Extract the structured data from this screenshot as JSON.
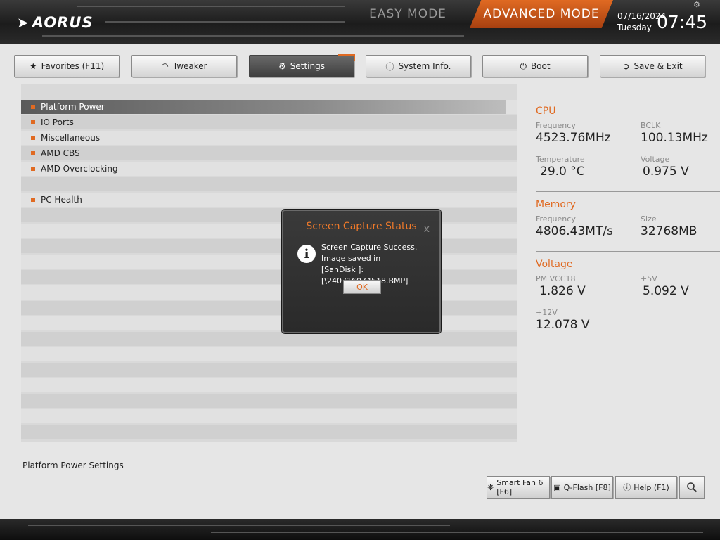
{
  "header": {
    "logo": "AORUS",
    "easy_mode": "EASY MODE",
    "advanced_mode": "ADVANCED MODE",
    "date": "07/16/2024",
    "day": "Tuesday",
    "time": "07:45"
  },
  "tabs": [
    {
      "label": "Favorites (F11)",
      "icon": "star-folder-icon"
    },
    {
      "label": "Tweaker",
      "icon": "gauge-icon"
    },
    {
      "label": "Settings",
      "icon": "gear-icon"
    },
    {
      "label": "System Info.",
      "icon": "info-icon"
    },
    {
      "label": "Boot",
      "icon": "power-icon"
    },
    {
      "label": "Save & Exit",
      "icon": "exit-icon"
    }
  ],
  "menu": [
    {
      "label": "Platform Power"
    },
    {
      "label": "IO Ports"
    },
    {
      "label": "Miscellaneous"
    },
    {
      "label": "AMD CBS"
    },
    {
      "label": "AMD Overclocking"
    },
    {
      "label": "PC Health"
    }
  ],
  "info": {
    "cpu": {
      "title": "CPU",
      "frequency_label": "Frequency",
      "frequency": "4523.76MHz",
      "bclk_label": "BCLK",
      "bclk": "100.13MHz",
      "temperature_label": "Temperature",
      "temperature": "29.0 °C",
      "voltage_label": "Voltage",
      "voltage": "0.975 V"
    },
    "memory": {
      "title": "Memory",
      "frequency_label": "Frequency",
      "frequency": "4806.43MT/s",
      "size_label": "Size",
      "size": "32768MB"
    },
    "voltage": {
      "title": "Voltage",
      "pm_vcc18_label": "PM VCC18",
      "pm_vcc18": "1.826 V",
      "v5_label": "+5V",
      "v5": "5.092 V",
      "v12_label": "+12V",
      "v12": "12.078 V"
    }
  },
  "description": "Platform Power Settings",
  "bottom_buttons": [
    {
      "label": "Smart Fan 6 [F6]",
      "icon": "fan-icon"
    },
    {
      "label": "Q-Flash [F8]",
      "icon": "chip-icon"
    },
    {
      "label": "Help (F1)",
      "icon": "help-icon"
    },
    {
      "label": "",
      "icon": "search-icon"
    }
  ],
  "dialog": {
    "title": "Screen Capture Status",
    "close": "x",
    "line1": "Screen Capture Success.",
    "line2": "Image saved in",
    "line3": "[SanDisk ]:[\\240716074518.BMP]",
    "ok": "OK"
  },
  "colors": {
    "accent": "#e06a22",
    "topbar": "#1c1c1c",
    "panel": "#d9d9d9"
  }
}
